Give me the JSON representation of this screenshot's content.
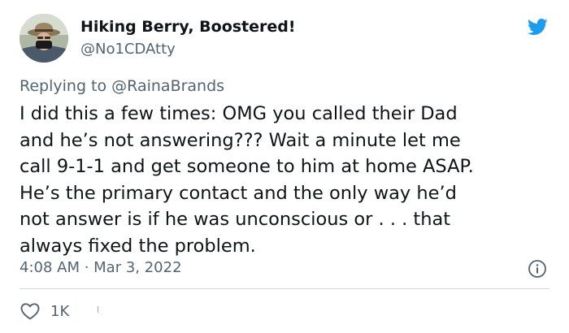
{
  "tweet": {
    "display_name": "Hiking Berry, Boostered!",
    "handle": "@No1CDAtty",
    "replying_label": "Replying to",
    "replying_handle": "@RainaBrands",
    "body_lines": [
      "I did this a few times: OMG you called their Dad",
      "and he’s not answering??? Wait a minute let me",
      "call 9-1-1 and get someone to him at home ASAP.",
      "He’s the primary contact and the only way he’d",
      "not answer is if he was unconscious or . . . that",
      "always fixed the problem."
    ],
    "timestamp": "4:08 AM · Mar 3, 2022",
    "likes": "1K"
  },
  "icons": {
    "brand": "twitter-bird-icon",
    "info": "info-icon",
    "like": "heart-icon"
  },
  "colors": {
    "twitter_blue": "#1d9bf0",
    "text_primary": "#0f1419",
    "text_secondary": "#536471",
    "divider": "#cfd9de"
  }
}
